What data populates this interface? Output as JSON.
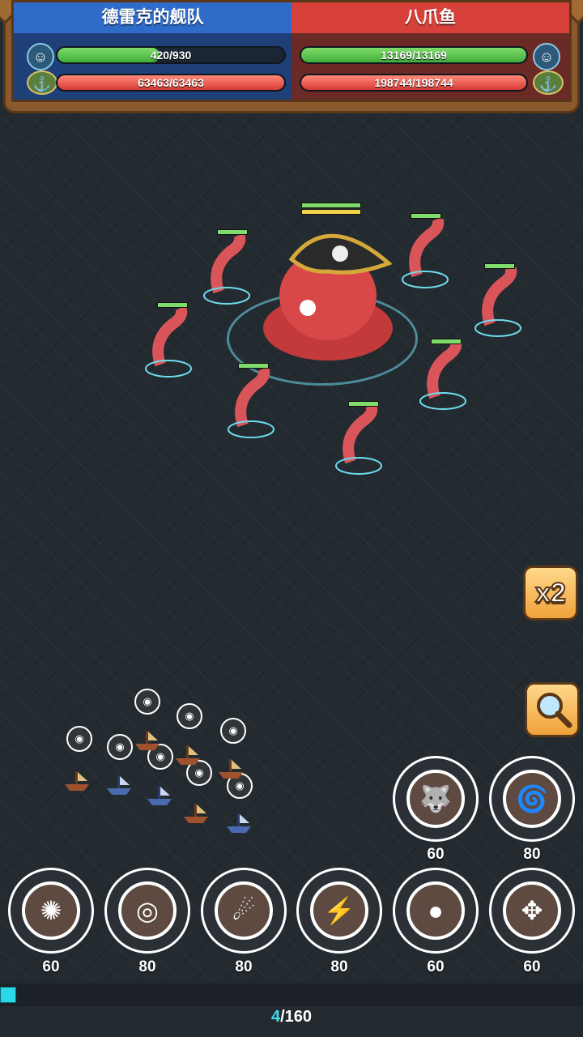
{
  "player": {
    "fleet_name": "德雷克的舰队",
    "crew_hp": "420/930",
    "crew_fraction": 0.45,
    "ship_hp": "63463/63463",
    "ship_fraction": 1.0
  },
  "enemy": {
    "name": "八爪鱼",
    "crew_hp": "13169/13169",
    "crew_fraction": 1.0,
    "ship_hp": "198744/198744",
    "ship_fraction": 1.0
  },
  "side_buttons": {
    "speed_label": "x2",
    "zoom_icon": "magnifier-icon"
  },
  "skills": {
    "top_row": [
      {
        "icon": "wolf-head-icon",
        "glyph": "🐺",
        "cost": "60"
      },
      {
        "icon": "tornado-icon",
        "glyph": "🌀",
        "cost": "80"
      }
    ],
    "bottom_row": [
      {
        "icon": "splash-icon",
        "glyph": "✺",
        "cost": "60"
      },
      {
        "icon": "vortex-icon",
        "glyph": "◎",
        "cost": "80"
      },
      {
        "icon": "fireball-icon",
        "glyph": "☄",
        "cost": "80"
      },
      {
        "icon": "lightning-orb-icon",
        "glyph": "⚡",
        "cost": "80"
      },
      {
        "icon": "cannonball-icon",
        "glyph": "●",
        "cost": "60"
      },
      {
        "icon": "target-icon",
        "glyph": "✥",
        "cost": "60"
      }
    ]
  },
  "progress": {
    "current": "4",
    "separator_total": "/160",
    "fraction": 0.025
  },
  "colors": {
    "player_banner": "#2f6bc9",
    "enemy_banner": "#d8403a",
    "hp_green": "#3fae3a",
    "hp_red": "#d93a34",
    "progress_cyan": "#2ad8e8"
  }
}
